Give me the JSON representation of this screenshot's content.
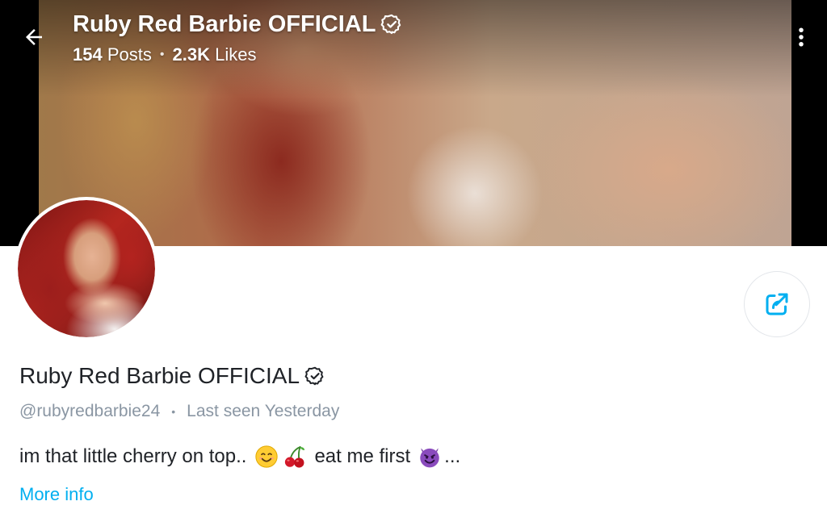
{
  "header": {
    "title": "Ruby Red Barbie OFFICIAL",
    "posts_count": "154",
    "posts_label": "Posts",
    "separator": "•",
    "likes_count": "2.3K",
    "likes_label": "Likes",
    "back_icon": "arrow-left-icon",
    "menu_icon": "more-vertical-icon"
  },
  "profile": {
    "name": "Ruby Red Barbie OFFICIAL",
    "verified_icon": "verified-badge-icon",
    "username": "@rubyredbarbie24",
    "separator": "•",
    "last_seen": "Last seen Yesterday",
    "bio_part1": "im that little cherry on top..",
    "bio_part2": "eat me first",
    "bio_ellipsis": "...",
    "bio_emojis": [
      "smiling-face-emoji",
      "cherries-emoji",
      "smiling-devil-emoji"
    ],
    "more_info": "More info"
  },
  "actions": {
    "share_icon": "share-icon"
  },
  "colors": {
    "accent": "#00aff0",
    "text_primary": "#1f2227",
    "text_secondary": "#8a96a3"
  }
}
